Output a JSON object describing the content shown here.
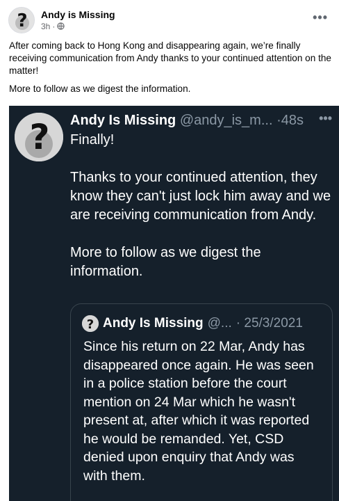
{
  "fb_post": {
    "author": "Andy is Missing",
    "time": "3h",
    "privacy_icon": "globe-icon",
    "more_icon": "more-horizontal-icon",
    "paragraphs": [
      "After coming back to Hong Kong and disappearing again, we’re finally receiving communication from Andy thanks to your continued attention on the matter!",
      "More to follow as we digest the information."
    ]
  },
  "tweet": {
    "name": "Andy Is Missing",
    "handle": "@andy_is_m...",
    "time": "·48s",
    "more_icon": "more-horizontal-icon",
    "paragraphs": [
      "Finally!",
      "Thanks to your continued attention, they know they can't just lock him away and we are receiving communication from Andy.",
      "More to follow as we digest the information."
    ],
    "quoted": {
      "name": "Andy Is Missing",
      "handle": "@...",
      "date": "· 25/3/2021",
      "text": "Since his return on 22 Mar, Andy has disappeared once again. He was seen in a police station before the court mention on 24 Mar which he wasn't present at, after which it was reported he would be remanded. Yet, CSD denied upon enquiry that Andy was with them."
    }
  },
  "colors": {
    "tweet_bg": "#15202b",
    "muted": "#8b98a5",
    "fb_muted": "#65676b"
  }
}
